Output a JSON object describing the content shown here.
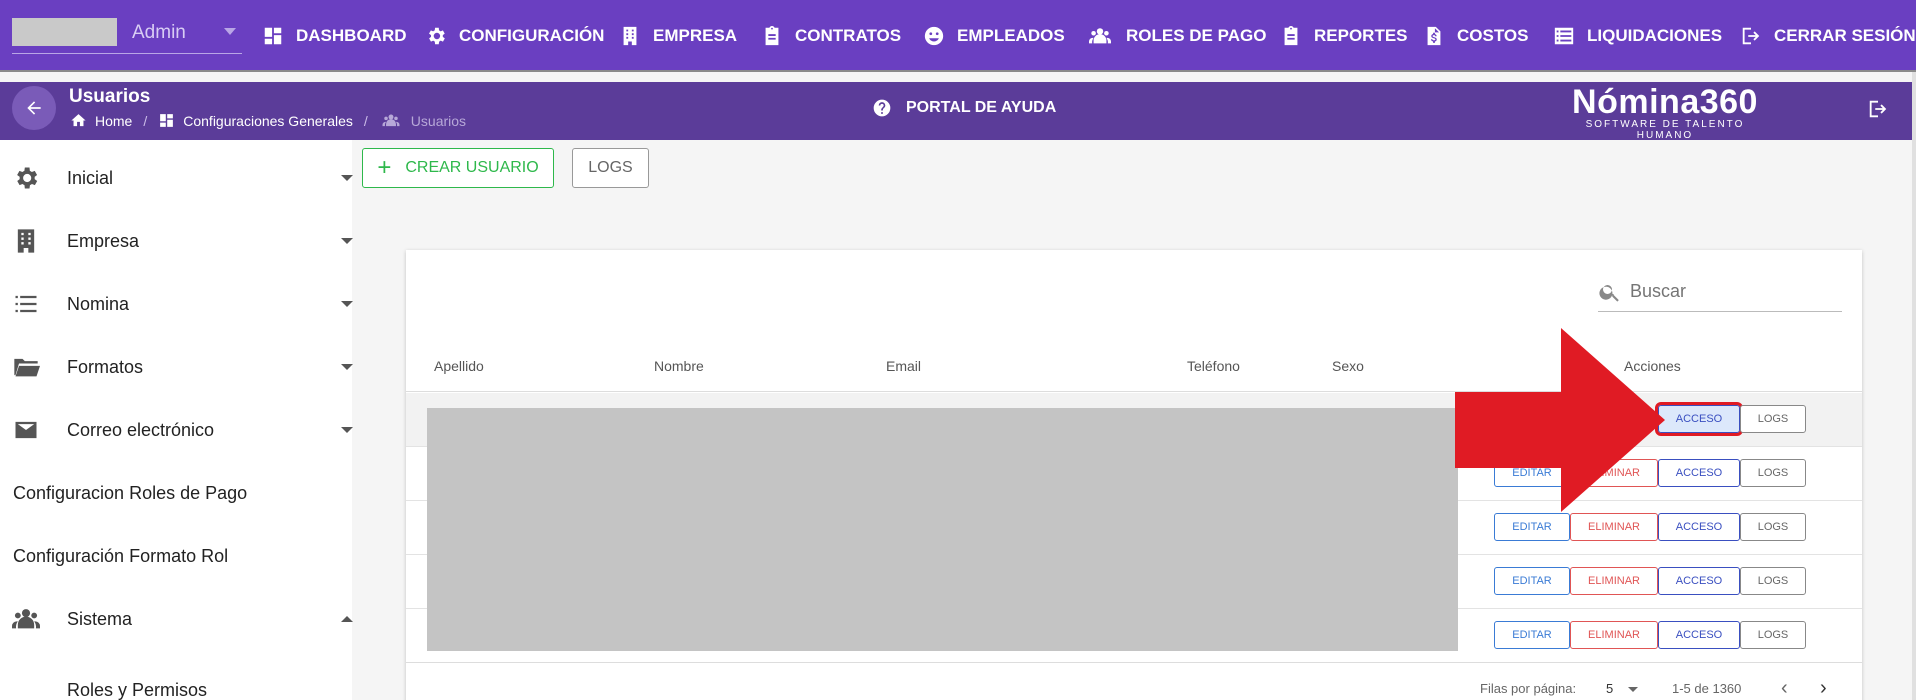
{
  "topnav": {
    "admin_label": "Admin",
    "items": [
      {
        "label": "DASHBOARD",
        "icon": "dashboard-icon"
      },
      {
        "label": "CONFIGURACIÓN",
        "icon": "gear-icon"
      },
      {
        "label": "EMPRESA",
        "icon": "building-icon"
      },
      {
        "label": "CONTRATOS",
        "icon": "clipboard-icon"
      },
      {
        "label": "EMPLEADOS",
        "icon": "face-icon"
      },
      {
        "label": "ROLES DE PAGO",
        "icon": "users-icon"
      },
      {
        "label": "REPORTES",
        "icon": "clipboard-icon"
      },
      {
        "label": "COSTOS",
        "icon": "dollar-file-icon"
      },
      {
        "label": "LIQUIDACIONES",
        "icon": "list-icon"
      },
      {
        "label": "CERRAR SESIÓN",
        "icon": "logout-icon"
      }
    ]
  },
  "header": {
    "title": "Usuarios",
    "breadcrumb": {
      "home": "Home",
      "config": "Configuraciones Generales",
      "current": "Usuarios"
    },
    "help": "PORTAL DE AYUDA",
    "brand": "Nómina360",
    "brand_tag": "SOFTWARE DE TALENTO HUMANO"
  },
  "sidebar": {
    "items": [
      {
        "label": "Inicial",
        "icon": "gear-icon",
        "caret": "down"
      },
      {
        "label": "Empresa",
        "icon": "building-icon",
        "caret": "down"
      },
      {
        "label": "Nomina",
        "icon": "list-icon",
        "caret": "down"
      },
      {
        "label": "Formatos",
        "icon": "folder-icon",
        "caret": "down"
      },
      {
        "label": "Correo electrónico",
        "icon": "mail-icon",
        "caret": "down"
      },
      {
        "label": "Configuracion Roles de Pago"
      },
      {
        "label": "Configuración Formato Rol"
      },
      {
        "label": "Sistema",
        "icon": "users-icon",
        "caret": "up"
      },
      {
        "label": "Roles y Permisos"
      }
    ]
  },
  "toolbar": {
    "create": "CREAR USUARIO",
    "logs": "LOGS"
  },
  "table": {
    "search_placeholder": "Buscar",
    "columns": [
      "Apellido",
      "Nombre",
      "Email",
      "Teléfono",
      "Sexo",
      "Acciones"
    ],
    "actions": {
      "edit": "EDITAR",
      "delete": "ELIMINAR",
      "access": "ACCESO",
      "logs": "LOGS"
    },
    "row_count": 5
  },
  "pager": {
    "rows_per_page_label": "Filas por página:",
    "rows_per_page": "5",
    "range": "1-5 de 1360",
    "prev": "‹",
    "next": "›"
  },
  "colors": {
    "nav": "#6a3fc1",
    "header": "#5b3c99",
    "create": "#2eb84b",
    "arrow": "#e01b24"
  }
}
